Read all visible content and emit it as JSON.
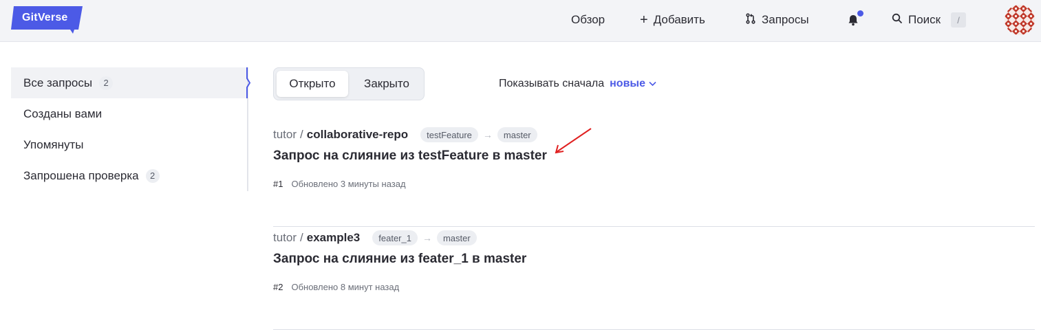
{
  "header": {
    "logo_text": "GitVerse",
    "nav": {
      "overview_label": "Обзор",
      "add_label": "Добавить",
      "requests_label": "Запросы",
      "search_label": "Поиск",
      "search_shortcut": "/"
    },
    "notification_indicator_color": "#4c5ae6",
    "brand_color": "#4c5ae6"
  },
  "sidebar": {
    "items": [
      {
        "label": "Все запросы",
        "count": "2",
        "active": true
      },
      {
        "label": "Созданы вами",
        "count": null,
        "active": false
      },
      {
        "label": "Упомянуты",
        "count": null,
        "active": false
      },
      {
        "label": "Запрошена проверка",
        "count": "2",
        "active": false
      }
    ]
  },
  "filter": {
    "open_label": "Открыто",
    "closed_label": "Закрыто",
    "selected": "open"
  },
  "sort": {
    "prefix": "Показывать сначала",
    "value": "новые"
  },
  "pull_requests": [
    {
      "owner": "tutor",
      "repo": "collaborative-repo",
      "source_branch": "testFeature",
      "target_branch": "master",
      "title": "Запрос на слияние из testFeature в master",
      "number": "#1",
      "updated": "Обновлено 3 минуты назад"
    },
    {
      "owner": "tutor",
      "repo": "example3",
      "source_branch": "feater_1",
      "target_branch": "master",
      "title": "Запрос на слияние из feater_1 в master",
      "number": "#2",
      "updated": "Обновлено 8 минут назад"
    }
  ],
  "annotation": {
    "arrow_color": "#e02020"
  }
}
